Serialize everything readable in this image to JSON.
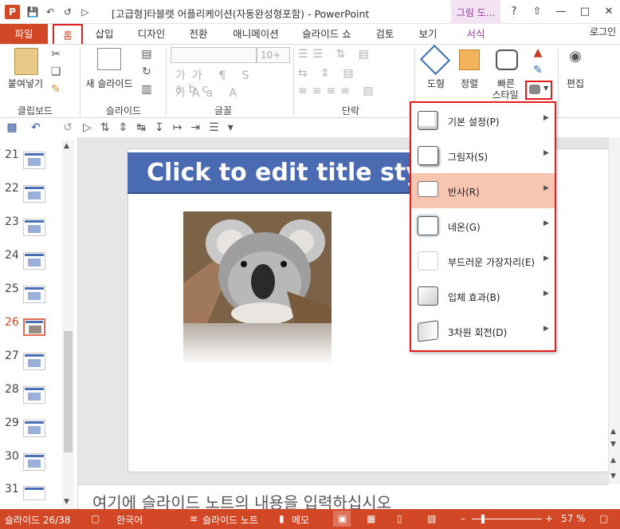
{
  "window": {
    "title": "[고급형]타블렛 어플리케이션(자동완성형포함) - PowerPoint",
    "app_icon": "P",
    "help": "?",
    "login": "로그인",
    "context_group_label": "그림 도..."
  },
  "tabs": [
    {
      "label": "파일"
    },
    {
      "label": "홈"
    },
    {
      "label": "삽입"
    },
    {
      "label": "디자인"
    },
    {
      "label": "전환"
    },
    {
      "label": "애니메이션"
    },
    {
      "label": "슬라이드 쇼"
    },
    {
      "label": "검토"
    },
    {
      "label": "보기"
    },
    {
      "label": "서식"
    }
  ],
  "ribbon": {
    "clipboard": {
      "paste": "붙여넣기",
      "group": "클립보드"
    },
    "slides": {
      "new_slide": "새 슬라이드",
      "group": "슬라이드"
    },
    "font": {
      "size_placeholder": "10+",
      "group": "글꼴"
    },
    "paragraph": {
      "group": "단락"
    },
    "drawing": {
      "shape": "도형",
      "arrange": "정렬",
      "quick_style_1": "빠른",
      "quick_style_2": "스타일"
    },
    "editing": {
      "label": "편집"
    }
  },
  "slides": {
    "numbers": [
      "21",
      "22",
      "23",
      "24",
      "25",
      "26",
      "27",
      "28",
      "29",
      "30",
      "31"
    ],
    "active": "26"
  },
  "slide": {
    "title": "Click to edit title style"
  },
  "notes": {
    "placeholder": "여기에 슬라이드 노트의 내용을 입력하십시오"
  },
  "status": {
    "slide_info": "슬라이드 26/38",
    "language": "한국어",
    "notes": "슬라이드 노트",
    "comments": "메모",
    "zoom": "57 %"
  },
  "effects_menu": {
    "items": [
      {
        "label": "기본 설정(P)"
      },
      {
        "label": "그림자(S)"
      },
      {
        "label": "반사(R)"
      },
      {
        "label": "네온(G)"
      },
      {
        "label": "부드러운 가장자리(E)"
      },
      {
        "label": "입체 효과(B)"
      },
      {
        "label": "3차원 회전(D)"
      }
    ],
    "highlighted": "반사(R)"
  },
  "colors": {
    "accent": "#d24726",
    "highlight": "#f8c5b0",
    "annotation": "#e31d1d",
    "title_bar": "#4a6ab1"
  }
}
